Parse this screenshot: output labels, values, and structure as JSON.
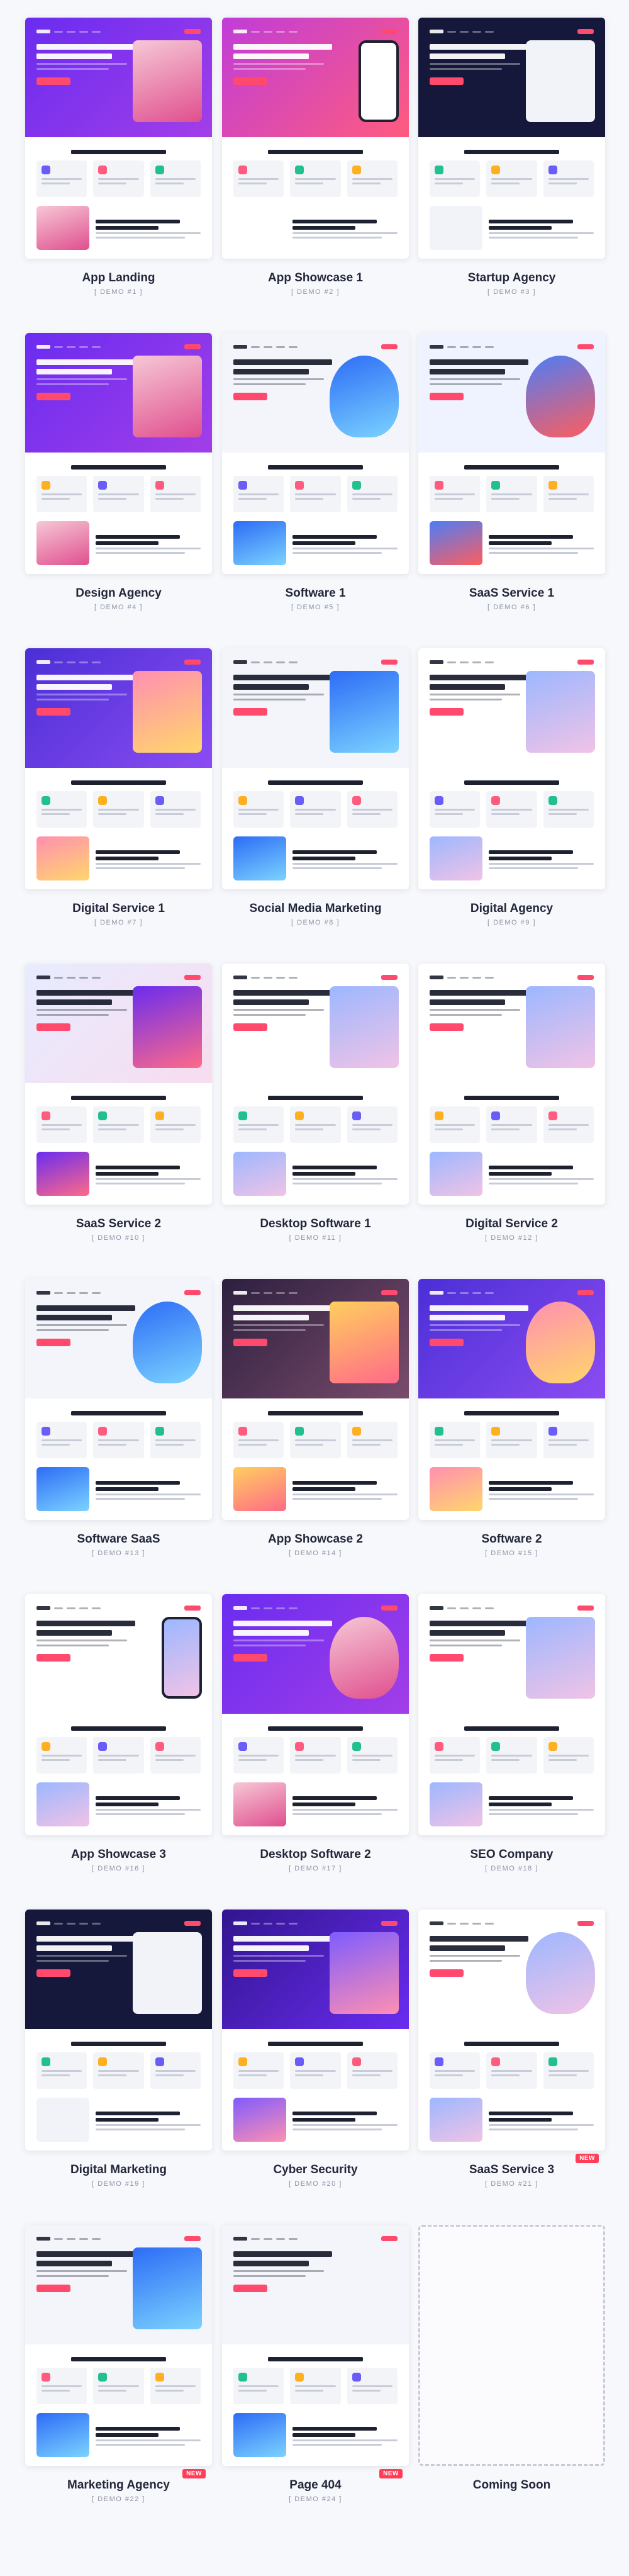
{
  "colors": {
    "accent": "#ff4a6e",
    "primary": "#6c3cf0",
    "blue": "#2d6cf6",
    "dark": "#1d2130"
  },
  "demos": [
    {
      "title": "App Landing",
      "sub": "[ DEMO #1 ]",
      "theme": "purple",
      "art": "photo",
      "badge": ""
    },
    {
      "title": "App Showcase 1",
      "sub": "[ DEMO #2 ]",
      "theme": "pink",
      "art": "phone",
      "badge": ""
    },
    {
      "title": "Startup Agency",
      "sub": "[ DEMO #3 ]",
      "theme": "dark",
      "art": "dash",
      "badge": ""
    },
    {
      "title": "Design Agency",
      "sub": "[ DEMO #4 ]",
      "theme": "purple",
      "art": "dash",
      "badge": ""
    },
    {
      "title": "Software 1",
      "sub": "[ DEMO #5 ]",
      "theme": "light",
      "art": "shoe",
      "badge": ""
    },
    {
      "title": "SaaS Service 1",
      "sub": "[ DEMO #6 ]",
      "theme": "blue-light",
      "art": "shoe",
      "badge": ""
    },
    {
      "title": "Digital Service 1",
      "sub": "[ DEMO #7 ]",
      "theme": "violet",
      "art": "grid",
      "badge": ""
    },
    {
      "title": "Social Media Marketing",
      "sub": "[ DEMO #8 ]",
      "theme": "light",
      "art": "illus",
      "badge": ""
    },
    {
      "title": "Digital Agency",
      "sub": "[ DEMO #9 ]",
      "theme": "white",
      "art": "illus",
      "badge": ""
    },
    {
      "title": "SaaS Service 2",
      "sub": "[ DEMO #10 ]",
      "theme": "gradient",
      "art": "photo",
      "badge": ""
    },
    {
      "title": "Desktop Software 1",
      "sub": "[ DEMO #11 ]",
      "theme": "white",
      "art": "photo",
      "badge": ""
    },
    {
      "title": "Digital Service 2",
      "sub": "[ DEMO #12 ]",
      "theme": "white",
      "art": "photo",
      "badge": ""
    },
    {
      "title": "Software SaaS",
      "sub": "[ DEMO #13 ]",
      "theme": "light",
      "art": "shoe",
      "badge": ""
    },
    {
      "title": "App Showcase 2",
      "sub": "[ DEMO #14 ]",
      "theme": "photo",
      "art": "photo",
      "badge": ""
    },
    {
      "title": "Software 2",
      "sub": "[ DEMO #15 ]",
      "theme": "violet",
      "art": "shoe",
      "badge": ""
    },
    {
      "title": "App Showcase 3",
      "sub": "[ DEMO #16 ]",
      "theme": "white",
      "art": "phone",
      "badge": ""
    },
    {
      "title": "Desktop Software 2",
      "sub": "[ DEMO #17 ]",
      "theme": "purple",
      "art": "shoe",
      "badge": ""
    },
    {
      "title": "SEO Company",
      "sub": "[ DEMO #18 ]",
      "theme": "white",
      "art": "illus",
      "badge": ""
    },
    {
      "title": "Digital Marketing",
      "sub": "[ DEMO #19 ]",
      "theme": "dark",
      "art": "dash",
      "badge": ""
    },
    {
      "title": "Cyber Security",
      "sub": "[ DEMO #20 ]",
      "theme": "deep-violet",
      "art": "illus",
      "badge": ""
    },
    {
      "title": "SaaS Service 3",
      "sub": "[ DEMO #21 ]",
      "theme": "white",
      "art": "shoe",
      "badge": "NEW"
    },
    {
      "title": "Marketing Agency",
      "sub": "[ DEMO #22 ]",
      "theme": "light",
      "art": "rocket",
      "badge": "NEW"
    },
    {
      "title": "Page 404",
      "sub": "[ DEMO #24 ]",
      "theme": "light",
      "art": "404",
      "badge": "NEW"
    },
    {
      "title": "Coming Soon",
      "sub": "",
      "theme": "soon",
      "art": "none",
      "badge": ""
    }
  ]
}
